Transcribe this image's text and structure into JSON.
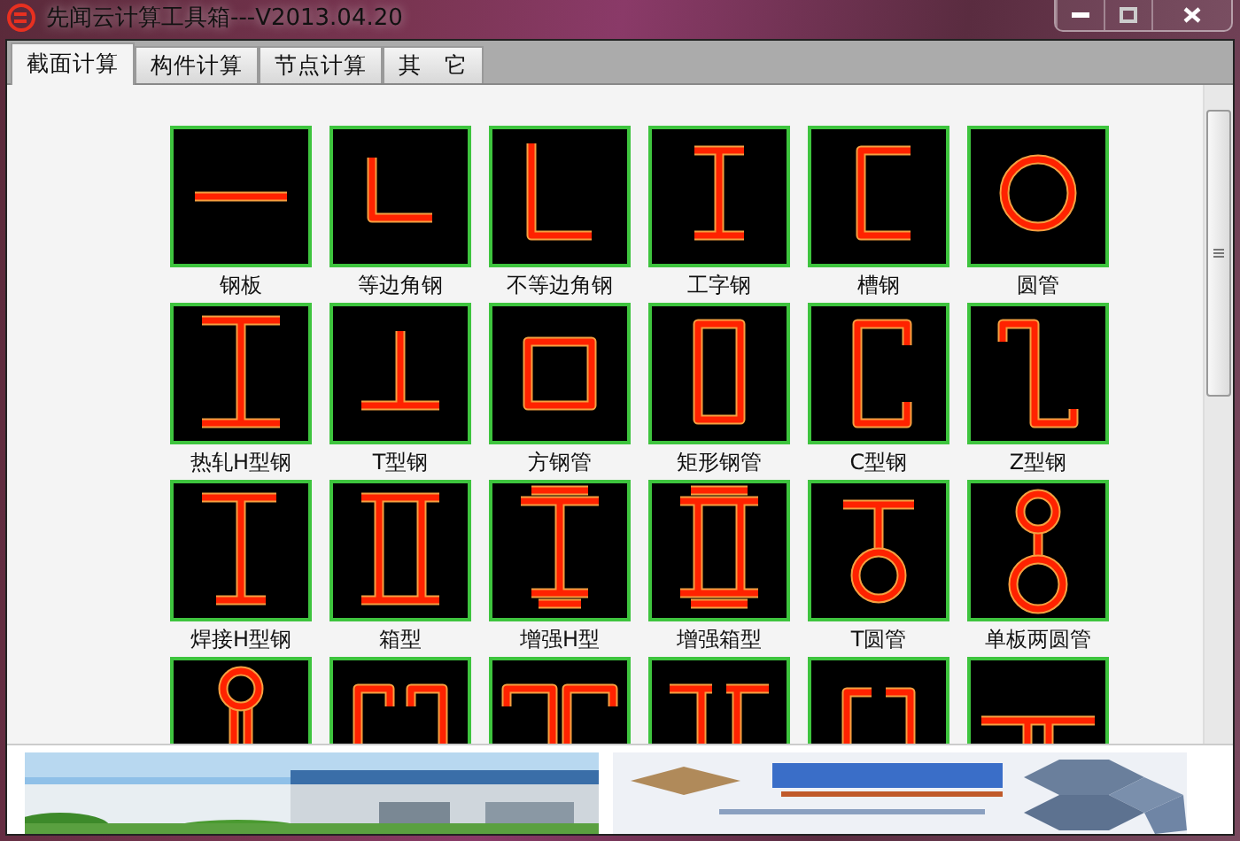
{
  "window": {
    "title": "先闻云计算工具箱---V2013.04.20"
  },
  "tabs": [
    {
      "label": "截面计算",
      "selected": true
    },
    {
      "label": "构件计算",
      "selected": false
    },
    {
      "label": "节点计算",
      "selected": false
    },
    {
      "label": "其　它",
      "selected": false
    }
  ],
  "sections": [
    {
      "label": "钢板",
      "kind": "plate"
    },
    {
      "label": "等边角钢",
      "kind": "equal-angle"
    },
    {
      "label": "不等边角钢",
      "kind": "unequal-angle"
    },
    {
      "label": "工字钢",
      "kind": "i-beam"
    },
    {
      "label": "槽钢",
      "kind": "channel"
    },
    {
      "label": "圆管",
      "kind": "pipe"
    },
    {
      "label": "热轧H型钢",
      "kind": "h-beam"
    },
    {
      "label": "T型钢",
      "kind": "t-steel"
    },
    {
      "label": "方钢管",
      "kind": "square-tube"
    },
    {
      "label": "矩形钢管",
      "kind": "rect-tube"
    },
    {
      "label": "C型钢",
      "kind": "c-steel"
    },
    {
      "label": "Z型钢",
      "kind": "z-steel"
    },
    {
      "label": "焊接H型钢",
      "kind": "welded-h"
    },
    {
      "label": "箱型",
      "kind": "box"
    },
    {
      "label": "增强H型",
      "kind": "reinforced-h"
    },
    {
      "label": "增强箱型",
      "kind": "reinforced-box"
    },
    {
      "label": "T圆管",
      "kind": "t-pipe"
    },
    {
      "label": "单板两圆管",
      "kind": "two-pipes"
    },
    {
      "kind": "pipe-plate"
    },
    {
      "kind": "double-channel"
    },
    {
      "kind": "double-hook"
    },
    {
      "kind": "double-t"
    },
    {
      "kind": "double-bracket"
    },
    {
      "kind": "wide-t"
    }
  ]
}
